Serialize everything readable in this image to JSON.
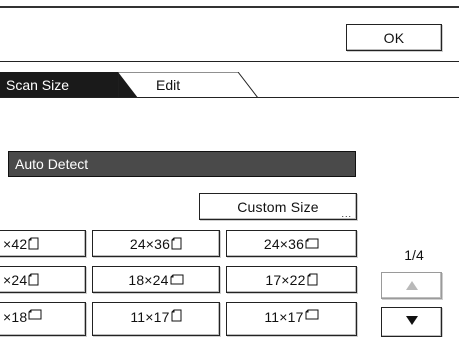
{
  "header": {
    "ok_label": "OK"
  },
  "tabs": [
    {
      "label": "Scan Size",
      "active": true
    },
    {
      "label": "Edit",
      "active": false
    }
  ],
  "auto_detect_label": "Auto Detect",
  "custom_size_label": "Custom Size",
  "custom_size_more": "...",
  "size_buttons": {
    "row1": [
      "×42",
      "24×36",
      "24×36"
    ],
    "row2": [
      "×24",
      "18×24",
      "17×22"
    ],
    "row3": [
      "×18",
      "11×17",
      "11×17"
    ]
  },
  "pagination": {
    "indicator": "1/4",
    "up_icon": "triangle-up",
    "down_icon": "triangle-down"
  },
  "colors": {
    "active_tab": "#1a1a1a",
    "auto_detect_bar": "#4a4a4a",
    "up_arrow_disabled": "#b9b9b9"
  }
}
